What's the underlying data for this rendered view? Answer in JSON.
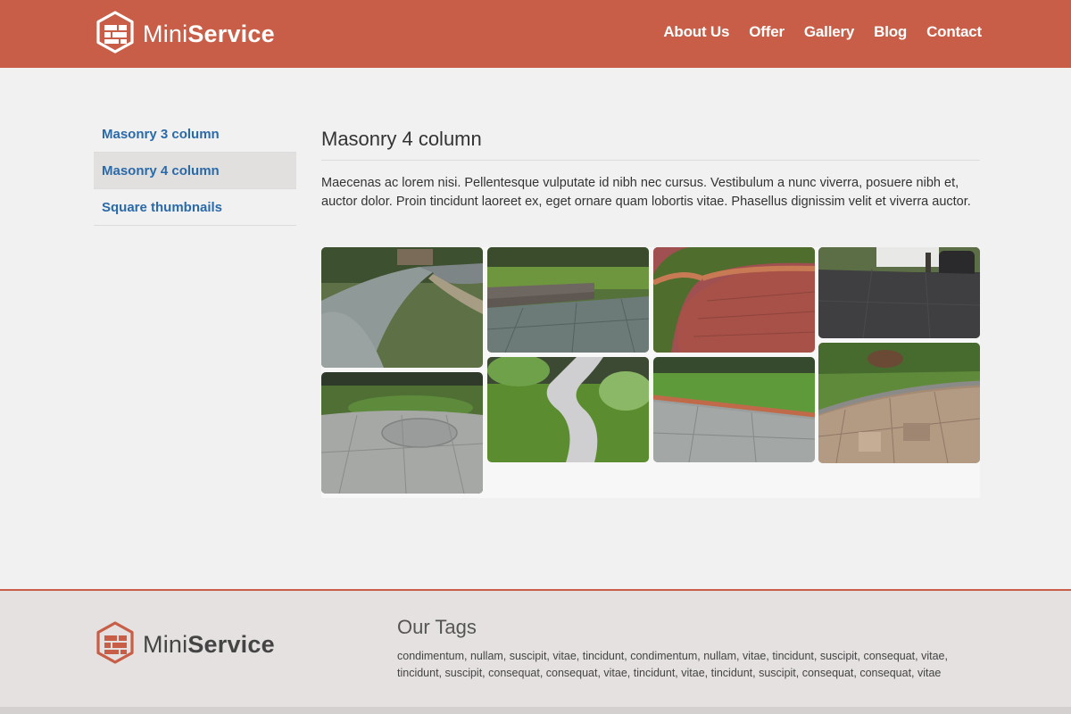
{
  "header": {
    "logo_light": "Mini",
    "logo_bold": "Service",
    "logo_icon": "brick-hexagon-icon",
    "nav": [
      "About Us",
      "Offer",
      "Gallery",
      "Blog",
      "Contact"
    ]
  },
  "sidebar": {
    "items": [
      {
        "label": "Masonry 3 column",
        "active": false
      },
      {
        "label": "Masonry 4 column",
        "active": true
      },
      {
        "label": "Square thumbnails",
        "active": false
      }
    ]
  },
  "main": {
    "title": "Masonry 4 column",
    "intro": "Maecenas ac lorem nisi. Pellentesque vulputate id nibh nec cursus. Vestibulum a nunc viverra, posuere nibh et, auctor dolor. Proin tincidunt laoreet ex, eget ornare quam lobortis vitae. Phasellus dignissim velit et viverra auctor."
  },
  "gallery": {
    "images": [
      {
        "name": "curved-paved-driveway-photo"
      },
      {
        "name": "slab-patio-steps-photo"
      },
      {
        "name": "red-brick-patio-photo"
      },
      {
        "name": "dark-tarmac-driveway-photo"
      },
      {
        "name": "circular-slab-patio-photo"
      },
      {
        "name": "winding-block-path-photo"
      },
      {
        "name": "grey-slab-patio-lawn-photo"
      },
      {
        "name": "sandstone-patio-photo"
      }
    ]
  },
  "footer": {
    "logo_light": "Mini",
    "logo_bold": "Service",
    "tags_title": "Our Tags",
    "tags": "condimentum, nullam, suscipit, vitae, tincidunt, condimentum, nullam, vitae, tincidunt, suscipit, consequat, vitae, tincidunt, suscipit, consequat, consequat, vitae, tincidunt, vitae, tincidunt, suscipit, consequat, consequat, vitae"
  },
  "colors": {
    "brand": "#c85e47",
    "link": "#2a6aa8",
    "background": "#f1f1f1",
    "footer": "#e4e1e0"
  }
}
